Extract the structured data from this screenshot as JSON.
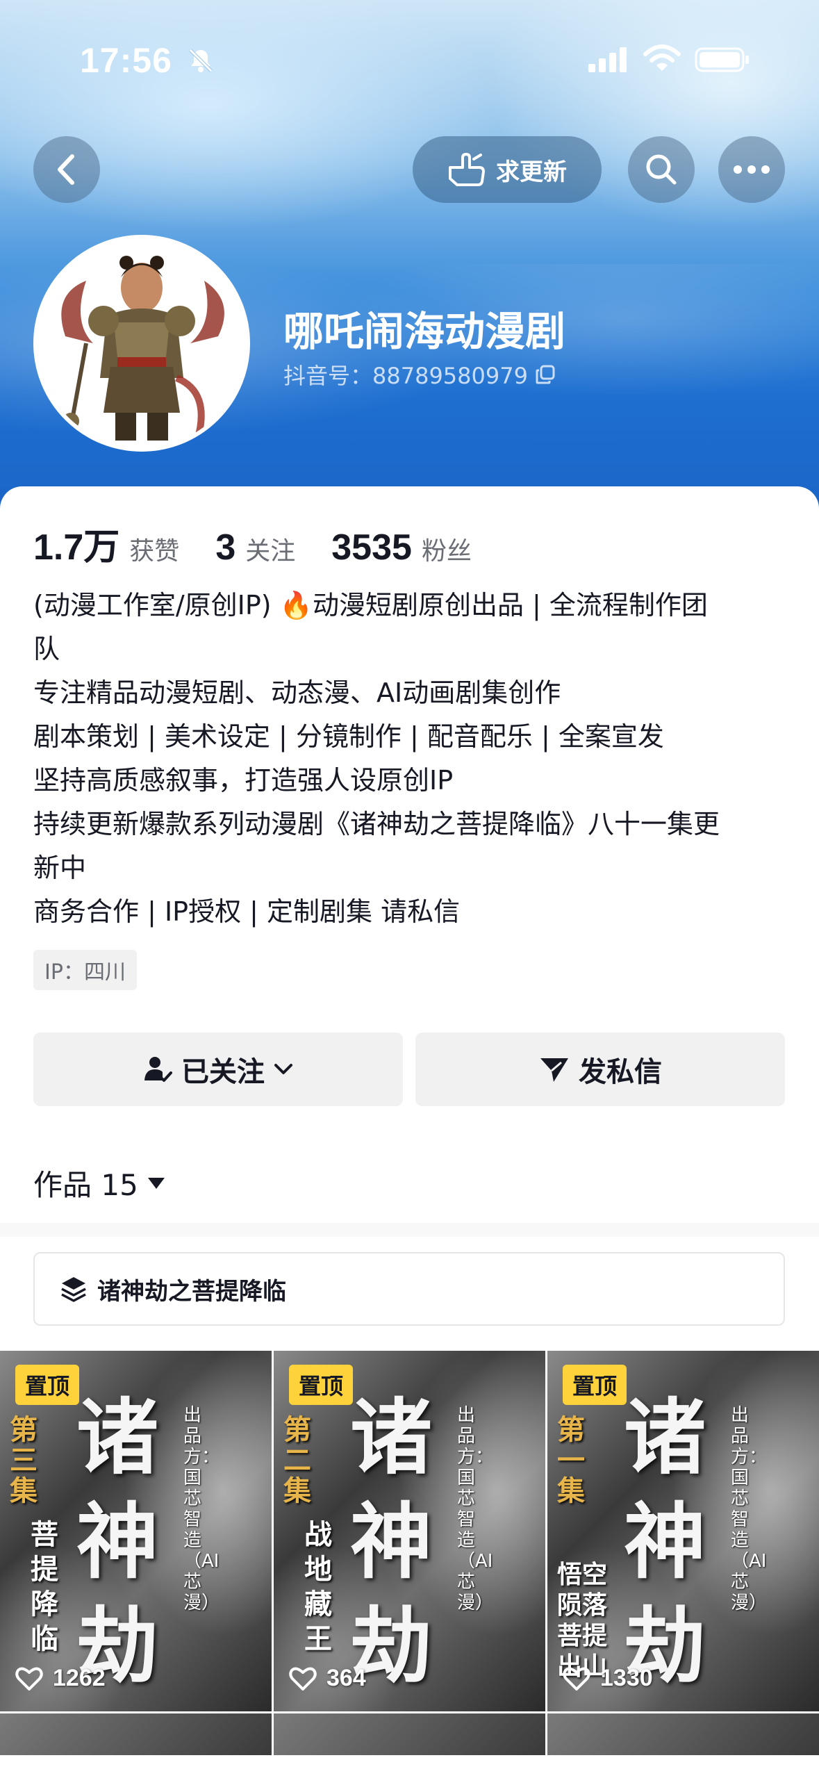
{
  "status_bar": {
    "time": "17:56"
  },
  "nav": {
    "update_label": "求更新"
  },
  "profile": {
    "name": "哪吒闹海动漫剧",
    "douyin_id": "抖音号：88789580979"
  },
  "stats": [
    {
      "value": "1.7万",
      "label": "获赞"
    },
    {
      "value": "3",
      "label": "关注"
    },
    {
      "value": "3535",
      "label": "粉丝"
    }
  ],
  "bio": [
    "(动漫工作室/原创IP) 🔥动漫短剧原创出品 | 全流程制作团",
    "队",
    "专注精品动漫短剧、动态漫、AI动画剧集创作",
    "剧本策划 | 美术设定 | 分镜制作 | 配音配乐 | 全案宣发",
    "坚持高质感叙事，打造强人设原创IP",
    "持续更新爆款系列动漫剧《诸神劫之菩提降临》八十一集更",
    "新中",
    "商务合作 | IP授权 | 定制剧集 请私信"
  ],
  "ip_location": "IP：四川",
  "actions": {
    "follow_label": "已关注",
    "message_label": "发私信"
  },
  "works": {
    "label": "作品 15"
  },
  "collection": {
    "title": "诸神劫之菩提降临"
  },
  "videos": [
    {
      "pin": "置顶",
      "likes": "1262",
      "title_chars": "诸神劫",
      "episode": "第三集",
      "subtitle": "菩提降临",
      "credit": "出品方：国芯智造（AI芯漫）"
    },
    {
      "pin": "置顶",
      "likes": "364",
      "title_chars": "诸神劫",
      "episode": "第二集",
      "subtitle": "战地藏王",
      "credit": "出品方：国芯智造（AI芯漫）"
    },
    {
      "pin": "置顶",
      "likes": "1330",
      "title_chars": "诸神劫",
      "episode": "第一集",
      "subtitle": "悟空陨落 菩提出山",
      "credit": "出品方：国芯智造（AI芯漫）"
    }
  ]
}
